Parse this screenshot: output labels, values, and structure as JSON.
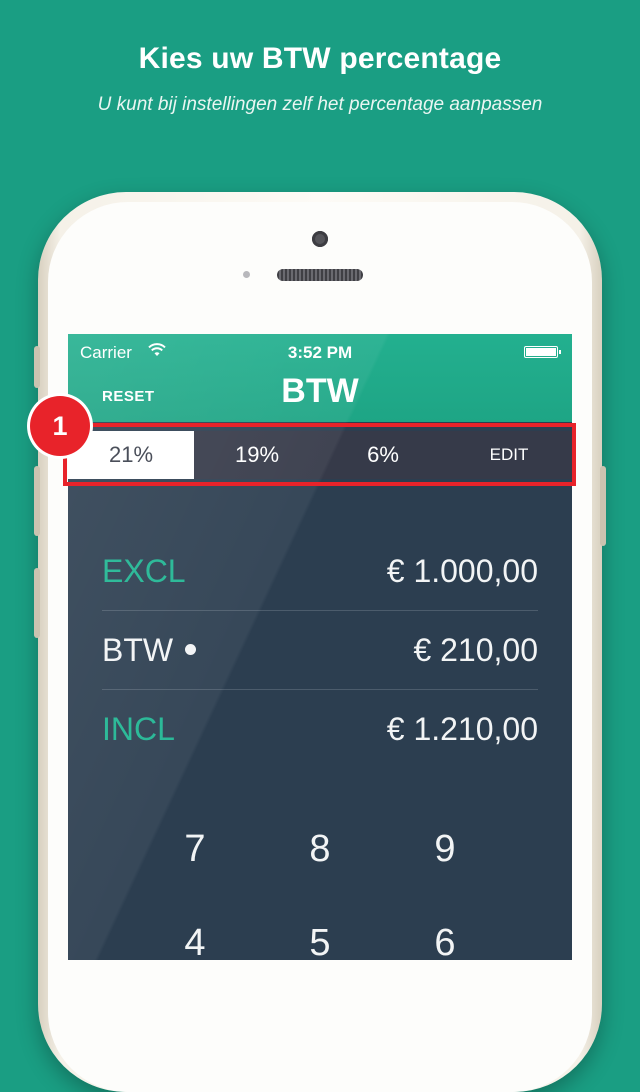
{
  "promo": {
    "title": "Kies uw BTW percentage",
    "subtitle": "U kunt bij instellingen zelf het percentage aanpassen"
  },
  "status_bar": {
    "carrier": "Carrier",
    "time": "3:52 PM",
    "wifi_icon": "wifi-icon",
    "battery_icon": "battery-icon"
  },
  "navbar": {
    "reset_label": "RESET",
    "title": "BTW"
  },
  "rate_selector": {
    "options": [
      "21%",
      "19%",
      "6%"
    ],
    "selected": "21%",
    "edit_label": "EDIT"
  },
  "callout": {
    "step_number": "1"
  },
  "amounts": {
    "excl_label": "EXCL",
    "excl_value": "€ 1.000,00",
    "btw_label": "BTW",
    "btw_value": "€ 210,00",
    "incl_label": "INCL",
    "incl_value": "€ 1.210,00"
  },
  "keypad": {
    "keys": [
      "7",
      "8",
      "9",
      "4",
      "5",
      "6"
    ]
  },
  "colors": {
    "background": "#1a9e83",
    "accent_green": "#1fb592",
    "screen_bg": "#2c3e50",
    "segment_bg": "#363a49",
    "highlight_red": "#e8232a"
  }
}
